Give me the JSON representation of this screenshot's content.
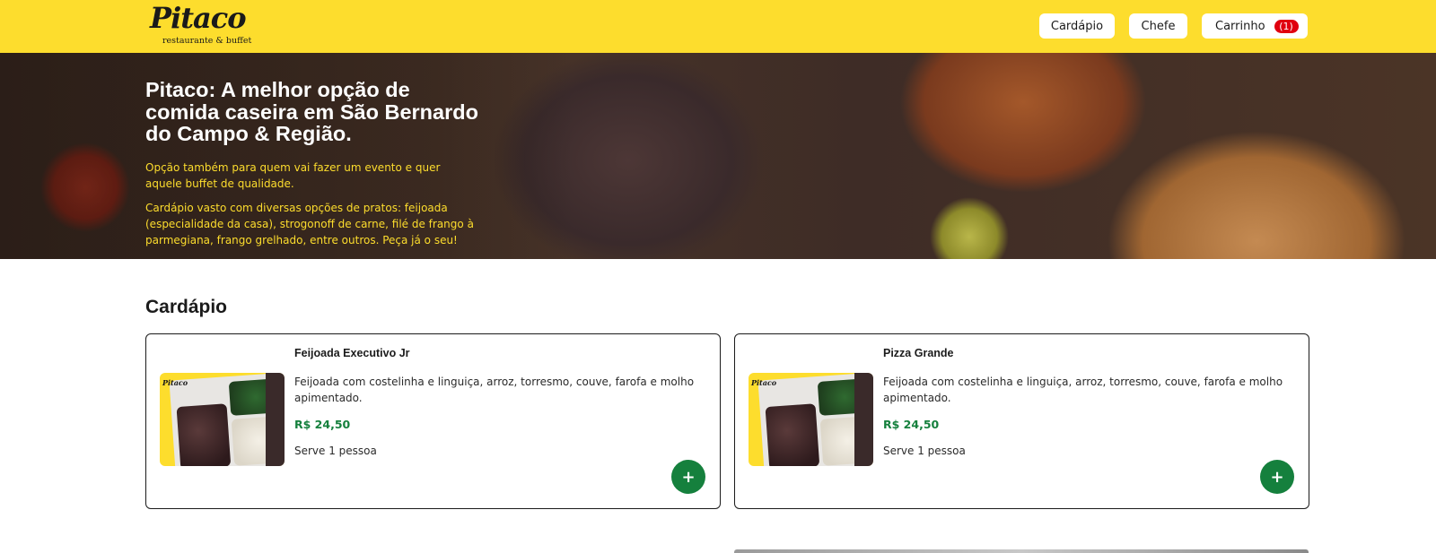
{
  "header": {
    "logo_text": "Pitaco",
    "logo_subtitle": "restaurante & buffet",
    "nav": {
      "cardapio": "Cardápio",
      "chefe": "Chefe",
      "carrinho": "Carrinho",
      "cart_count": "(1)"
    },
    "colors": {
      "brand_yellow": "#fddd2d",
      "badge_red": "#e0000f"
    }
  },
  "hero": {
    "title": "Pitaco: A melhor opção de comida caseira em São Bernardo do Campo & Região.",
    "paragraph1": "Opção também para quem vai fazer um evento e quer aquele buffet de qualidade.",
    "paragraph2": "Cardápio vasto com diversas opções de pratos: feijoada (especialidade da casa), strogonoff de carne, filé de frango à parmegiana, frango grelhado, entre outros. Peça já o seu!"
  },
  "menu": {
    "title": "Cardápio",
    "items": [
      {
        "name": "Feijoada Executivo Jr",
        "description": "Feijoada com costelinha e linguiça, arroz, torresmo, couve, farofa e molho apimentado.",
        "price": "R$ 24,50",
        "serves": "Serve 1 pessoa",
        "add_label": "+",
        "image_logo": "Pitaco"
      },
      {
        "name": "Pizza Grande",
        "description": "Feijoada com costelinha e linguiça, arroz, torresmo, couve, farofa e molho apimentado.",
        "price": "R$ 24,50",
        "serves": "Serve 1 pessoa",
        "add_label": "+",
        "image_logo": "Pitaco"
      }
    ],
    "colors": {
      "price_green": "#15803d",
      "button_green": "#15803d"
    }
  }
}
